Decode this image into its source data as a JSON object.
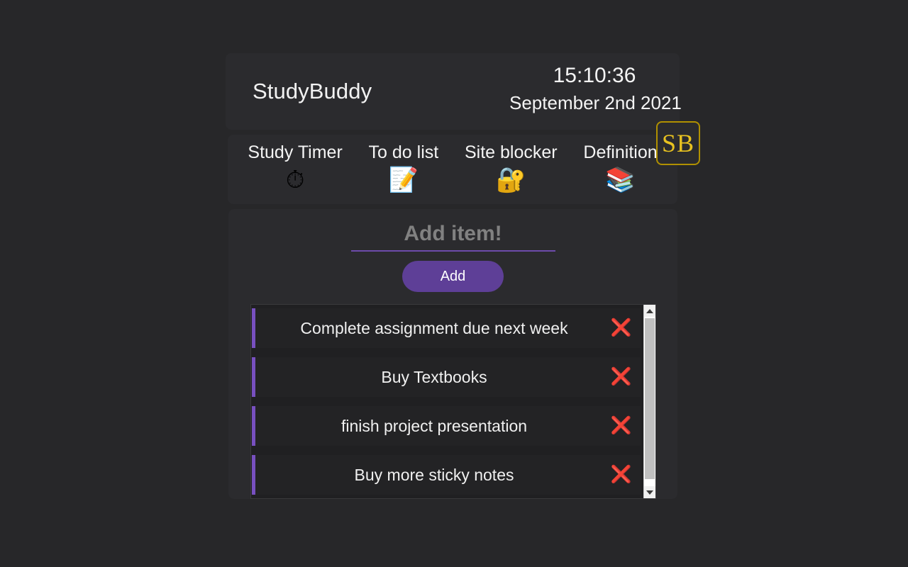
{
  "theme": {
    "page_background": "#272729",
    "panel_background": "#2b2b2e",
    "accent_purple": "#5e3f97",
    "item_accent_purple": "#7850c0",
    "logo_gold": "#e8c220",
    "text_primary": "#f4f4f4",
    "placeholder_grey": "#818181",
    "delete_red": "#e8402a"
  },
  "header": {
    "app_title": "StudyBuddy",
    "logo_text": "SB",
    "logo_icon_name": "studybuddy-logo",
    "time": "15:10:36",
    "date": "September 2nd 2021"
  },
  "nav": {
    "items": [
      {
        "label": "Study Timer",
        "icon": "⏱",
        "icon_name": "timer-icon"
      },
      {
        "label": "To do list",
        "icon": "📝",
        "icon_name": "memo-icon"
      },
      {
        "label": "Site blocker",
        "icon": "🔐",
        "icon_name": "lock-icon"
      },
      {
        "label": "Definition",
        "icon": "📚",
        "icon_name": "books-icon"
      }
    ]
  },
  "main": {
    "add": {
      "input_value": "",
      "placeholder": "Add item!",
      "button_label": "Add"
    },
    "todo_list": {
      "delete_icon": "❌",
      "items": [
        {
          "text": "Complete assignment due next week"
        },
        {
          "text": "Buy Textbooks"
        },
        {
          "text": "finish project presentation"
        },
        {
          "text": "Buy more sticky notes"
        }
      ],
      "scrollbar": {
        "up_arrow": "▲",
        "down_arrow": "▼"
      }
    }
  }
}
